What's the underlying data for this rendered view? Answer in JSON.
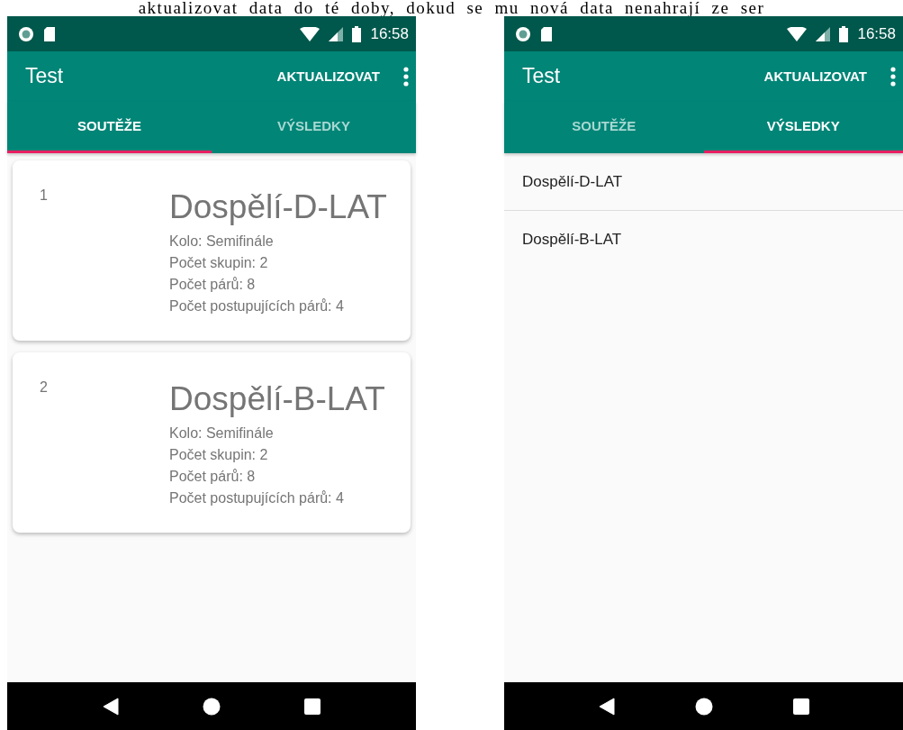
{
  "document_text": "aktualizovat data do té doby, dokud se mu nová data nenahrají ze ser",
  "screens": [
    {
      "status_bar": {
        "time": "16:58"
      },
      "app_bar": {
        "title": "Test",
        "action": "AKTUALIZOVAT"
      },
      "tabs": [
        {
          "label": "SOUTĚŽE",
          "selected": true
        },
        {
          "label": "VÝSLEDKY",
          "selected": false
        }
      ],
      "content": {
        "kind": "cards",
        "items": [
          {
            "number": "1",
            "title": "Dospělí-D-LAT",
            "details": [
              "Kolo: Semifinále",
              "Počet skupin: 2",
              "Počet párů: 8",
              "Počet postupujících párů: 4"
            ]
          },
          {
            "number": "2",
            "title": "Dospělí-B-LAT",
            "details": [
              "Kolo: Semifinále",
              "Počet skupin: 2",
              "Počet párů: 8",
              "Počet postupujících párů: 4"
            ]
          }
        ]
      }
    },
    {
      "status_bar": {
        "time": "16:58"
      },
      "app_bar": {
        "title": "Test",
        "action": "AKTUALIZOVAT"
      },
      "tabs": [
        {
          "label": "SOUTĚŽE",
          "selected": false
        },
        {
          "label": "VÝSLEDKY",
          "selected": true
        }
      ],
      "content": {
        "kind": "list",
        "items": [
          {
            "title": "Dospělí-D-LAT"
          },
          {
            "title": "Dospělí-B-LAT"
          }
        ]
      }
    }
  ]
}
